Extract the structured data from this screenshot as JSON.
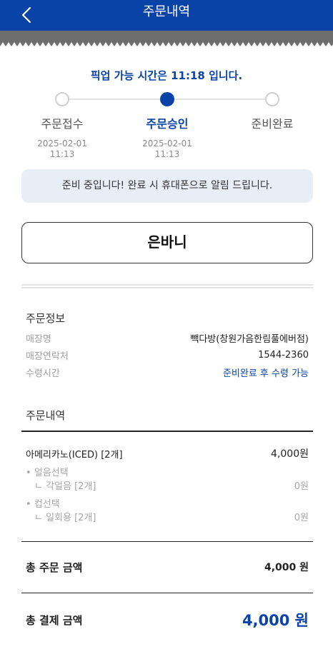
{
  "header": {
    "title": "주문내역"
  },
  "status": {
    "pickup_text": "픽업 가능 시간은 11:18 입니다.",
    "steps": [
      {
        "label": "주문접수",
        "date": "2025-02-01",
        "time": "11:13",
        "active": false
      },
      {
        "label": "주문승인",
        "date": "2025-02-01",
        "time": "11:13",
        "active": true
      },
      {
        "label": "준비완료",
        "date": "",
        "time": "",
        "active": false
      }
    ],
    "notice": "준비 중입니다! 완료 시 휴대폰으로 알림 드립니다."
  },
  "customer": {
    "name": "은바니"
  },
  "order_info": {
    "title": "주문정보",
    "rows": [
      {
        "label": "매장명",
        "value": "빽다방(창원가음한림풀에버점)"
      },
      {
        "label": "매장연락처",
        "value": "1544-2360"
      },
      {
        "label": "수령시간",
        "value": "준비완료 후 수령 가능"
      }
    ]
  },
  "order_details": {
    "title": "주문내역",
    "item": {
      "name": "아메리카노(ICED) [2개]",
      "price": "4,000원"
    },
    "options": [
      {
        "group": "얼음선택",
        "choice": "ㄴ 각얼음 [2개]",
        "price": "0원"
      },
      {
        "group": "컵선택",
        "choice": "ㄴ 일회용 [2개]",
        "price": "0원"
      }
    ]
  },
  "totals": {
    "order_label": "총 주문 금액",
    "order_value": "4,000 원",
    "pay_label": "총 결제 금액",
    "pay_value": "4,000 원"
  },
  "colors": {
    "brand": "#0a43a8",
    "band": "#6e6e6e",
    "notice_bg": "#e8eef7"
  },
  "icons": {
    "back": "chevron-left-icon"
  }
}
